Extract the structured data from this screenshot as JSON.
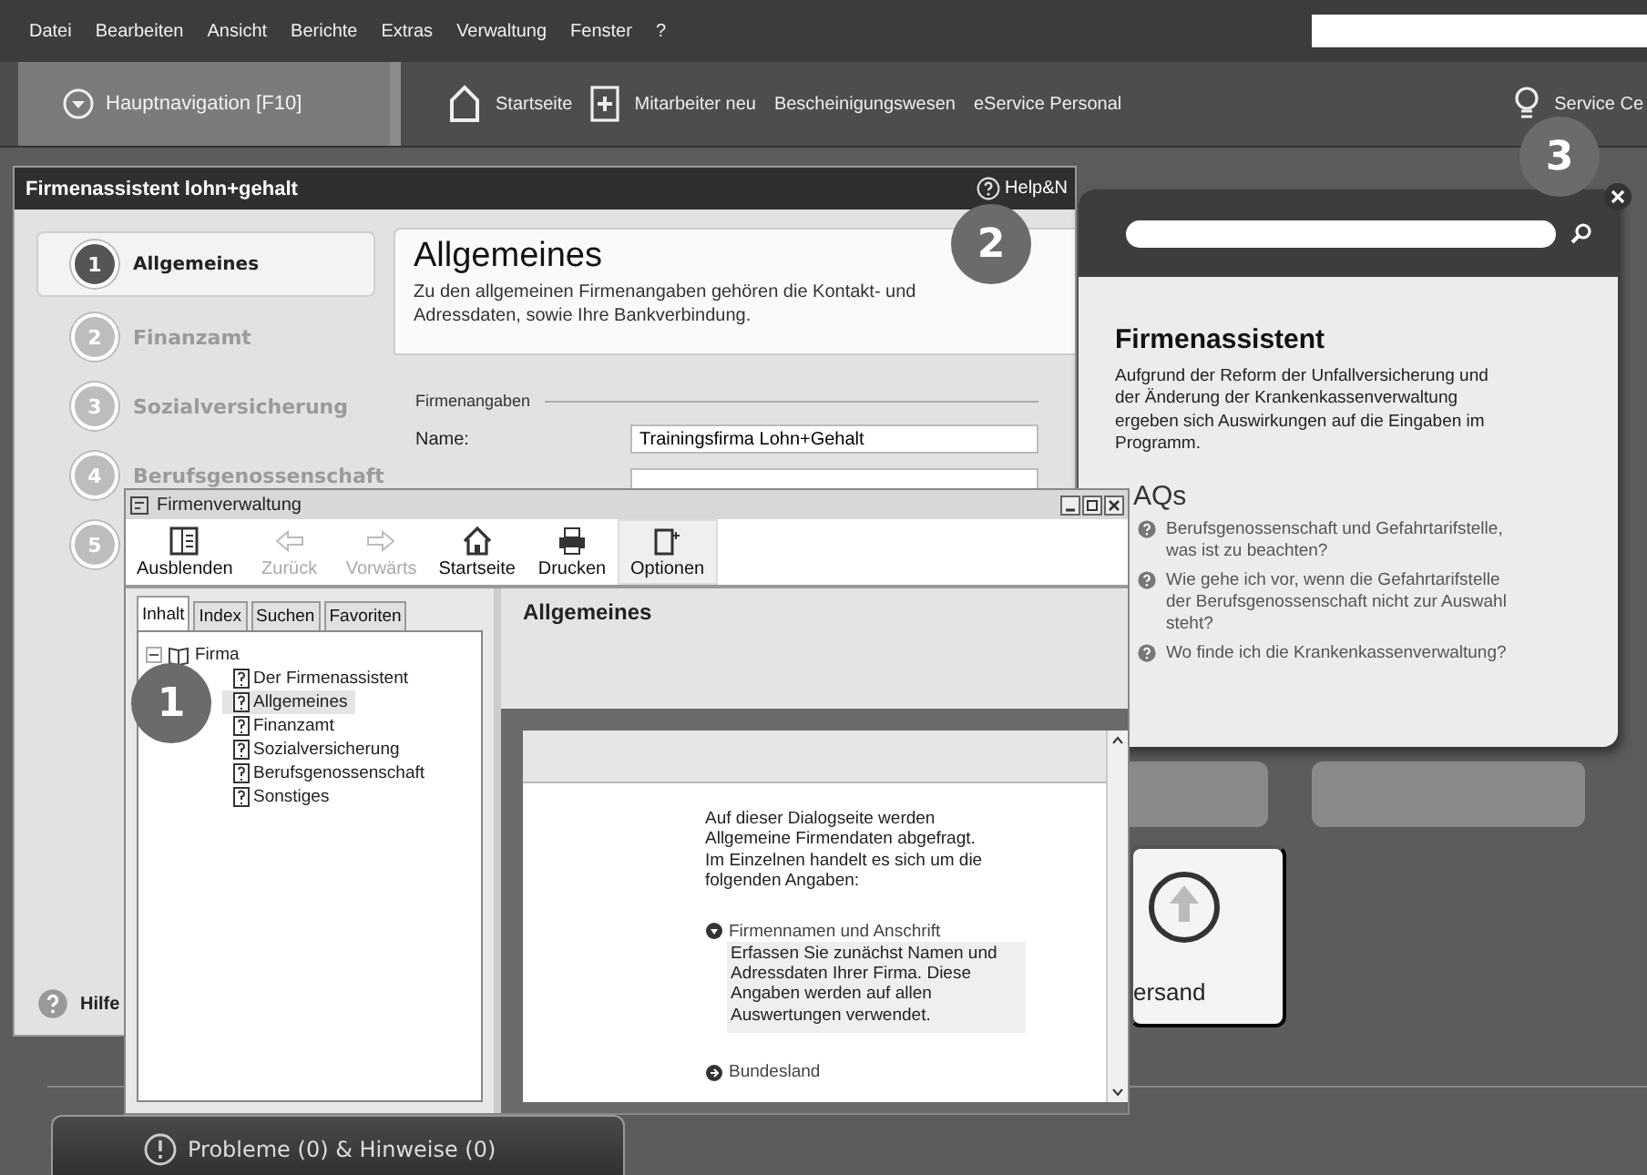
{
  "menu_bar": {
    "items": [
      "Datei",
      "Bearbeiten",
      "Ansicht",
      "Berichte",
      "Extras",
      "Verwaltung",
      "Fenster",
      "?"
    ]
  },
  "nav_bar": {
    "main_button": "Hauptnavigation [F10]",
    "links": [
      {
        "label": "Startseite",
        "kind": "home"
      },
      {
        "label": "Mitarbeiter neu",
        "kind": "add"
      },
      {
        "label": "Bescheinigungswesen",
        "kind": "text"
      },
      {
        "label": "eService Personal",
        "kind": "text"
      },
      {
        "label": "Service Ce",
        "kind": "bulb"
      }
    ]
  },
  "wizard": {
    "title": "Firmenassistent lohn+gehalt",
    "help_label": "Help&N",
    "steps": [
      {
        "number": "1",
        "label": "Allgemeines",
        "selected": true
      },
      {
        "number": "2",
        "label": "Finanzamt",
        "selected": false
      },
      {
        "number": "3",
        "label": "Sozialversicherung",
        "selected": false
      },
      {
        "number": "4",
        "label": "Berufsgenossenschaft",
        "selected": false
      },
      {
        "number": "5",
        "selected": false
      }
    ],
    "content": {
      "title": "Allgemeines",
      "description": "Zu den allgemeinen Firmenangaben gehören die Kontakt- und Adressdaten, sowie Ihre Bankverbindung.",
      "section": "Firmenangaben",
      "fields": [
        {
          "label": "Name:",
          "value": "Trainingsfirma Lohn+Gehalt"
        }
      ]
    },
    "footer_help": "Hilfe"
  },
  "tiles": [
    {
      "label": "ersand"
    }
  ],
  "service_panel": {
    "title": "Firmenassistent",
    "text": "Aufgrund der Reform der Unfallversicherung und der Änderung der Krankenkassenverwaltung ergeben sich Auswirkungen auf die Eingaben im Programm.",
    "faq_heading": "AQs",
    "faqs": [
      "Berufsgenossenschaft und Gefahrtarifstelle, was ist zu beachten?",
      "Wie gehe ich vor, wenn die Gefahrtarifstelle der Berufsgenossenschaft nicht zur Auswahl steht?",
      "Wo finde ich die Krankenkassenverwaltung?"
    ]
  },
  "help_window": {
    "title": "Firmenverwaltung",
    "toolbar": [
      {
        "label": "Ausblenden",
        "kind": "hide",
        "disabled": false
      },
      {
        "label": "Zurück",
        "kind": "back",
        "disabled": true
      },
      {
        "label": "Vorwärts",
        "kind": "forward",
        "disabled": true
      },
      {
        "label": "Startseite",
        "kind": "home",
        "disabled": false
      },
      {
        "label": "Drucken",
        "kind": "print",
        "disabled": false
      },
      {
        "label": "Optionen",
        "kind": "options",
        "disabled": false
      }
    ],
    "tabs": [
      {
        "label": "Inhalt",
        "selected": true
      },
      {
        "label": "Index",
        "selected": false
      },
      {
        "label": "Suchen",
        "selected": false
      },
      {
        "label": "Favoriten",
        "selected": false
      }
    ],
    "tree": [
      {
        "label": "Firma",
        "expanded": true,
        "children": [
          {
            "label": "Der Firmenassistent",
            "selected": false
          },
          {
            "label": "Allgemeines",
            "selected": true
          },
          {
            "label": "Finanzamt",
            "selected": false
          },
          {
            "label": "Sozialversicherung",
            "selected": false
          },
          {
            "label": "Berufsgenossenschaft",
            "selected": false
          },
          {
            "label": "Sonstiges",
            "selected": false
          }
        ]
      }
    ],
    "page": {
      "title": "Allgemeines",
      "intro": "Auf dieser Dialogseite werden Allgemeine Firmendaten abgefragt. Im Einzelnen handelt es sich um die folgenden Angaben:",
      "sections": [
        {
          "title": "Firmennamen und Anschrift",
          "expanded": true,
          "text": "Erfassen Sie zunächst Namen und Adressdaten Ihrer Firma. Diese Angaben werden auf allen Auswertungen verwendet."
        },
        {
          "title": "Bundesland",
          "expanded": false
        }
      ]
    }
  },
  "callouts": [
    "1",
    "2",
    "3"
  ],
  "status_tab": "Probleme (0) & Hinweise (0)"
}
